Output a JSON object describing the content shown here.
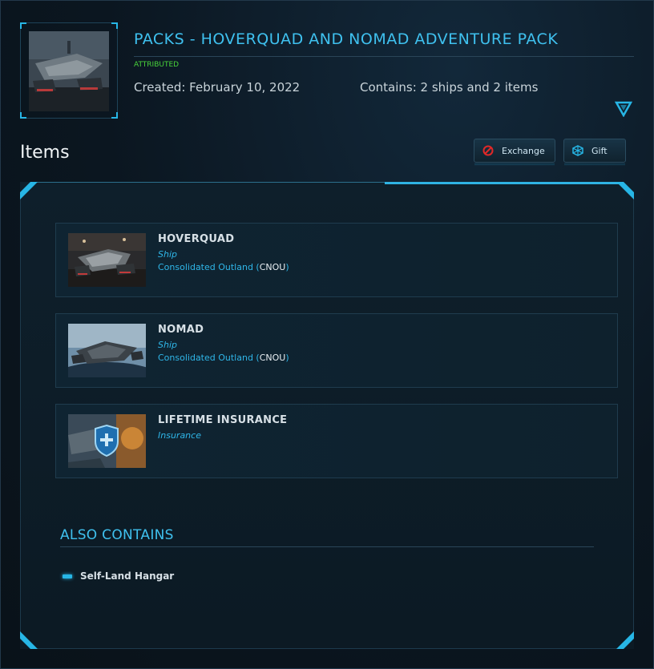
{
  "pack": {
    "title": "PACKS - HOVERQUAD AND NOMAD ADVENTURE PACK",
    "status": "ATTRIBUTED",
    "created": "Created: February 10, 2022",
    "contains": "Contains: 2 ships and 2 items",
    "thumbnail_icon": "pack-ship-image"
  },
  "items_section": {
    "heading": "Items",
    "exchange_label": "Exchange",
    "gift_label": "Gift"
  },
  "items": [
    {
      "name": "HOVERQUAD",
      "type": "Ship",
      "manufacturer": "Consolidated Outland",
      "code": "CNOU"
    },
    {
      "name": "NOMAD",
      "type": "Ship",
      "manufacturer": "Consolidated Outland",
      "code": "CNOU"
    },
    {
      "name": "LIFETIME INSURANCE",
      "type": "Insurance"
    }
  ],
  "also_contains": {
    "heading": "ALSO CONTAINS",
    "items": [
      "Self-Land Hangar"
    ]
  },
  "colors": {
    "accent": "#27b6e6",
    "status_green": "#49d43a",
    "background": "#0b1620"
  }
}
